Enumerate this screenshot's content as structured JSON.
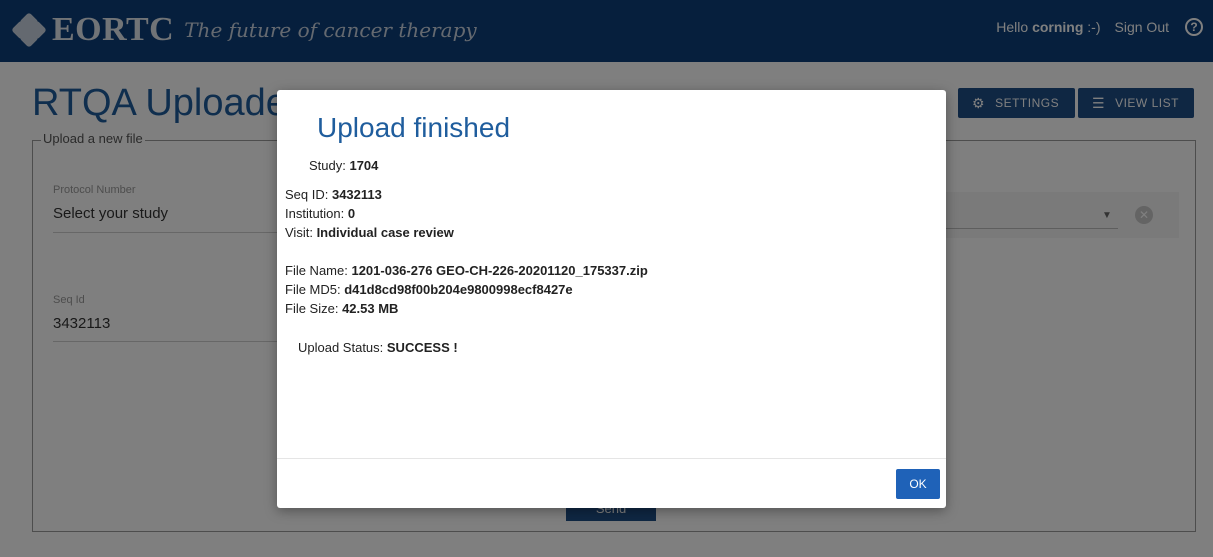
{
  "header": {
    "logo_text": "EORTC",
    "tagline": "The future of cancer therapy",
    "greeting_prefix": "Hello ",
    "username": "corning",
    "greeting_suffix": " :-)",
    "sign_out": "Sign Out",
    "help_glyph": "?"
  },
  "page": {
    "title": "RTQA Uploader",
    "buttons": {
      "settings": "SETTINGS",
      "view_list": "VIEW LIST"
    },
    "fieldset_legend": "Upload a new file",
    "protocol": {
      "label": "Protocol Number",
      "value": "Select your study"
    },
    "seq": {
      "label": "Seq Id",
      "value": "3432113"
    },
    "bottom_button": "Send"
  },
  "modal": {
    "title": "Upload finished",
    "study_label": "Study: ",
    "study_value": "1704",
    "seq_label": "Seq ID: ",
    "seq_value": "3432113",
    "institution_label": "Institution: ",
    "institution_value": "0",
    "visit_label": "Visit: ",
    "visit_value": "Individual case review",
    "filename_label": "File Name: ",
    "filename_value": "1201-036-276 GEO-CH-226-20201120_175337.zip",
    "md5_label": "File MD5: ",
    "md5_value": "d41d8cd98f00b204e9800998ecf8427e",
    "size_label": "File Size: ",
    "size_value": "42.53 MB",
    "status_label": "Upload Status: ",
    "status_value": "SUCCESS !",
    "ok": "OK"
  },
  "colors": {
    "header_bg": "#0d3f7a",
    "accent_blue": "#1f5d9d",
    "button_blue": "#1f4e87",
    "ok_blue": "#1f62b8"
  },
  "icons": [
    "gear-icon",
    "list-icon",
    "help-icon",
    "caret-down-icon",
    "clear-icon"
  ]
}
